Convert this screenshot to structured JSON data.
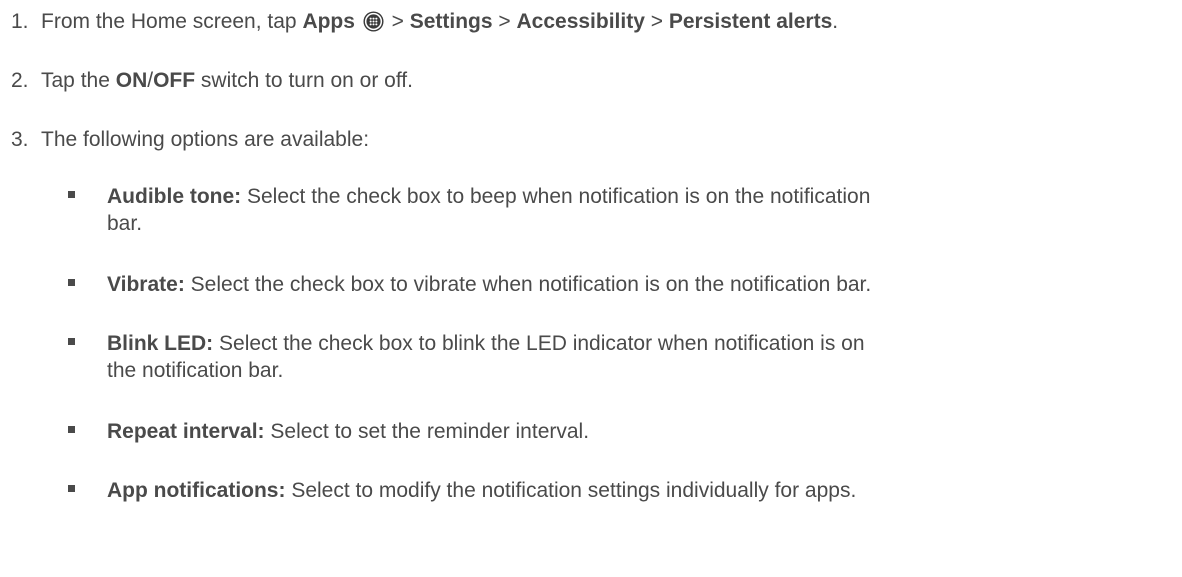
{
  "steps": [
    {
      "num": "1.",
      "parts": [
        "From the Home screen, tap ",
        "Apps",
        " > ",
        "Settings",
        " > ",
        "Accessibility",
        " > ",
        "Persistent alerts",
        "."
      ],
      "icon": "apps-grid-icon"
    },
    {
      "num": "2.",
      "parts": [
        "Tap the ",
        "ON",
        "/",
        "OFF",
        " switch to turn on or off."
      ]
    },
    {
      "num": "3.",
      "text": "The following options are available:"
    }
  ],
  "options": [
    {
      "label": "Audible tone:",
      "line1": " Select the check box to beep when notification is on the notification",
      "line2": "bar."
    },
    {
      "label": "Vibrate:",
      "line1": " Select the check box to vibrate when notification is on the notification bar."
    },
    {
      "label": "Blink LED:",
      "line1": " Select the check box to blink the LED indicator when notification is on",
      "line2": "the notification bar."
    },
    {
      "label": "Repeat interval:",
      "line1": " Select to set the reminder interval."
    },
    {
      "label": "App notifications:",
      "line1": " Select to modify the notification settings individually for apps."
    }
  ]
}
